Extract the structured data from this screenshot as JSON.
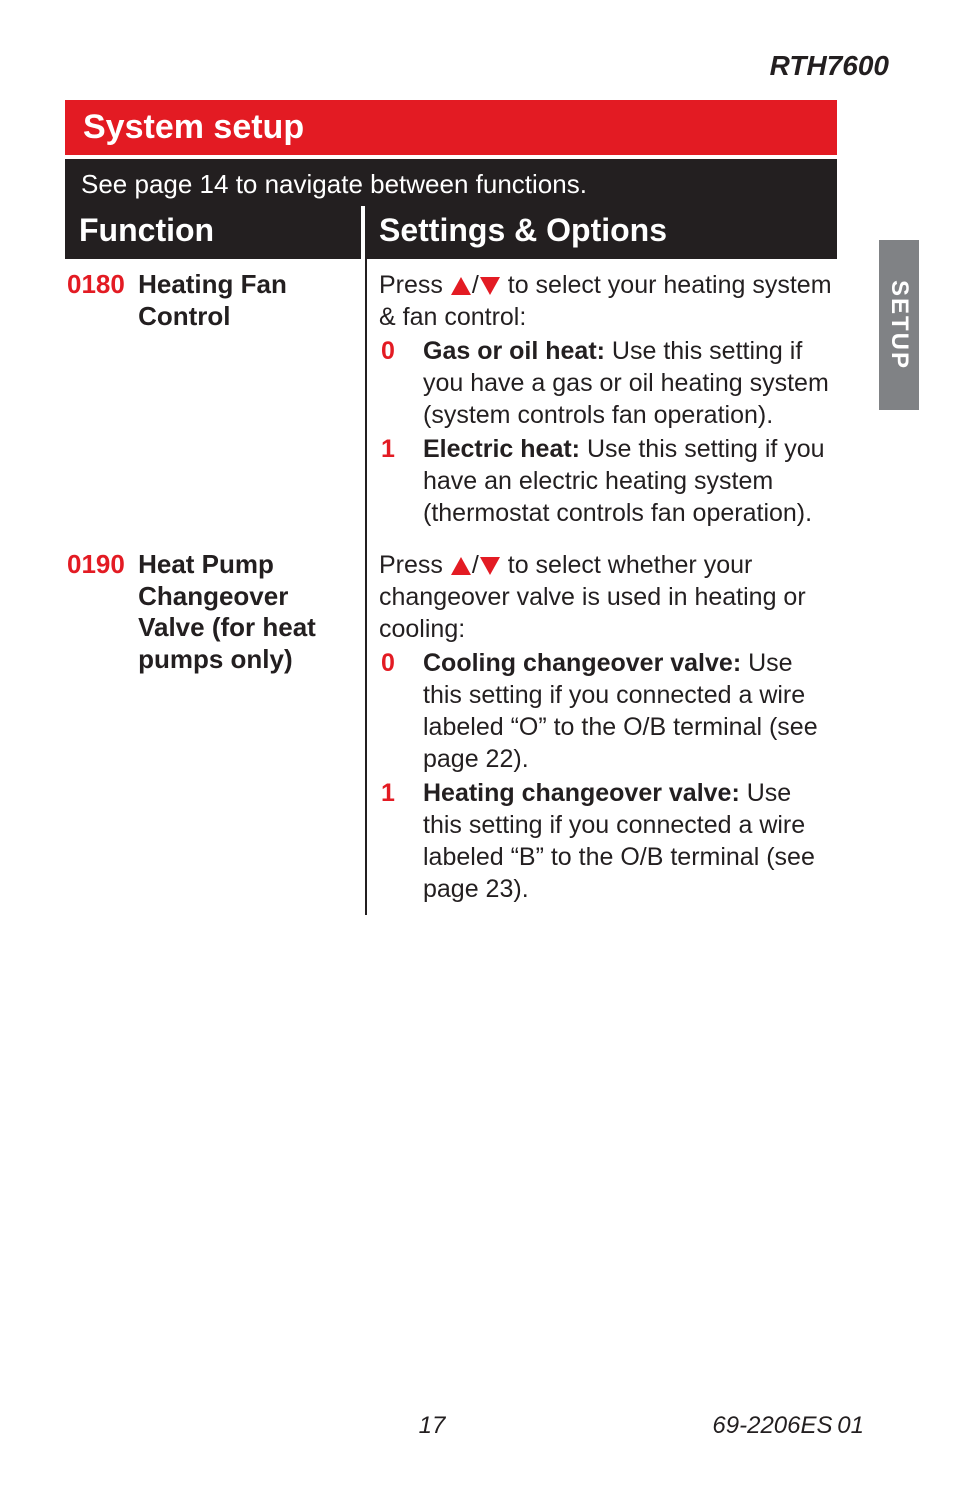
{
  "header": {
    "model": "RTH7600"
  },
  "section_title": "System setup",
  "nav_note": "See page 14 to navigate between functions.",
  "columns": {
    "function": "Function",
    "settings": "Settings & Options"
  },
  "side_tab": "SETUP",
  "rows": [
    {
      "code": "0180",
      "name": "Heating Fan Control",
      "intro_pre": "Press ",
      "intro_post": " to select your heating system & fan control:",
      "options": [
        {
          "num": "0",
          "title": "Gas or oil heat:",
          "text": " Use this setting if you have a gas or oil heating system (system controls fan operation)."
        },
        {
          "num": "1",
          "title": "Electric heat:",
          "text": " Use this setting if you have an electric heating system (thermostat controls fan operation)."
        }
      ]
    },
    {
      "code": "0190",
      "name": "Heat Pump Changeover Valve (for heat pumps only)",
      "intro_pre": "Press ",
      "intro_post": " to select whether your changeover valve is used in heating or cooling:",
      "options": [
        {
          "num": "0",
          "title": "Cooling changeover valve:",
          "text": " Use this setting if you connected a wire labeled “O” to the O/B terminal (see page 22)."
        },
        {
          "num": "1",
          "title": "Heating changeover valve:",
          "text": " Use this setting if you connected a wire labeled “B” to the O/B terminal (see page 23)."
        }
      ]
    }
  ],
  "footer": {
    "page": "17",
    "doc": "69-2206ES 01"
  }
}
